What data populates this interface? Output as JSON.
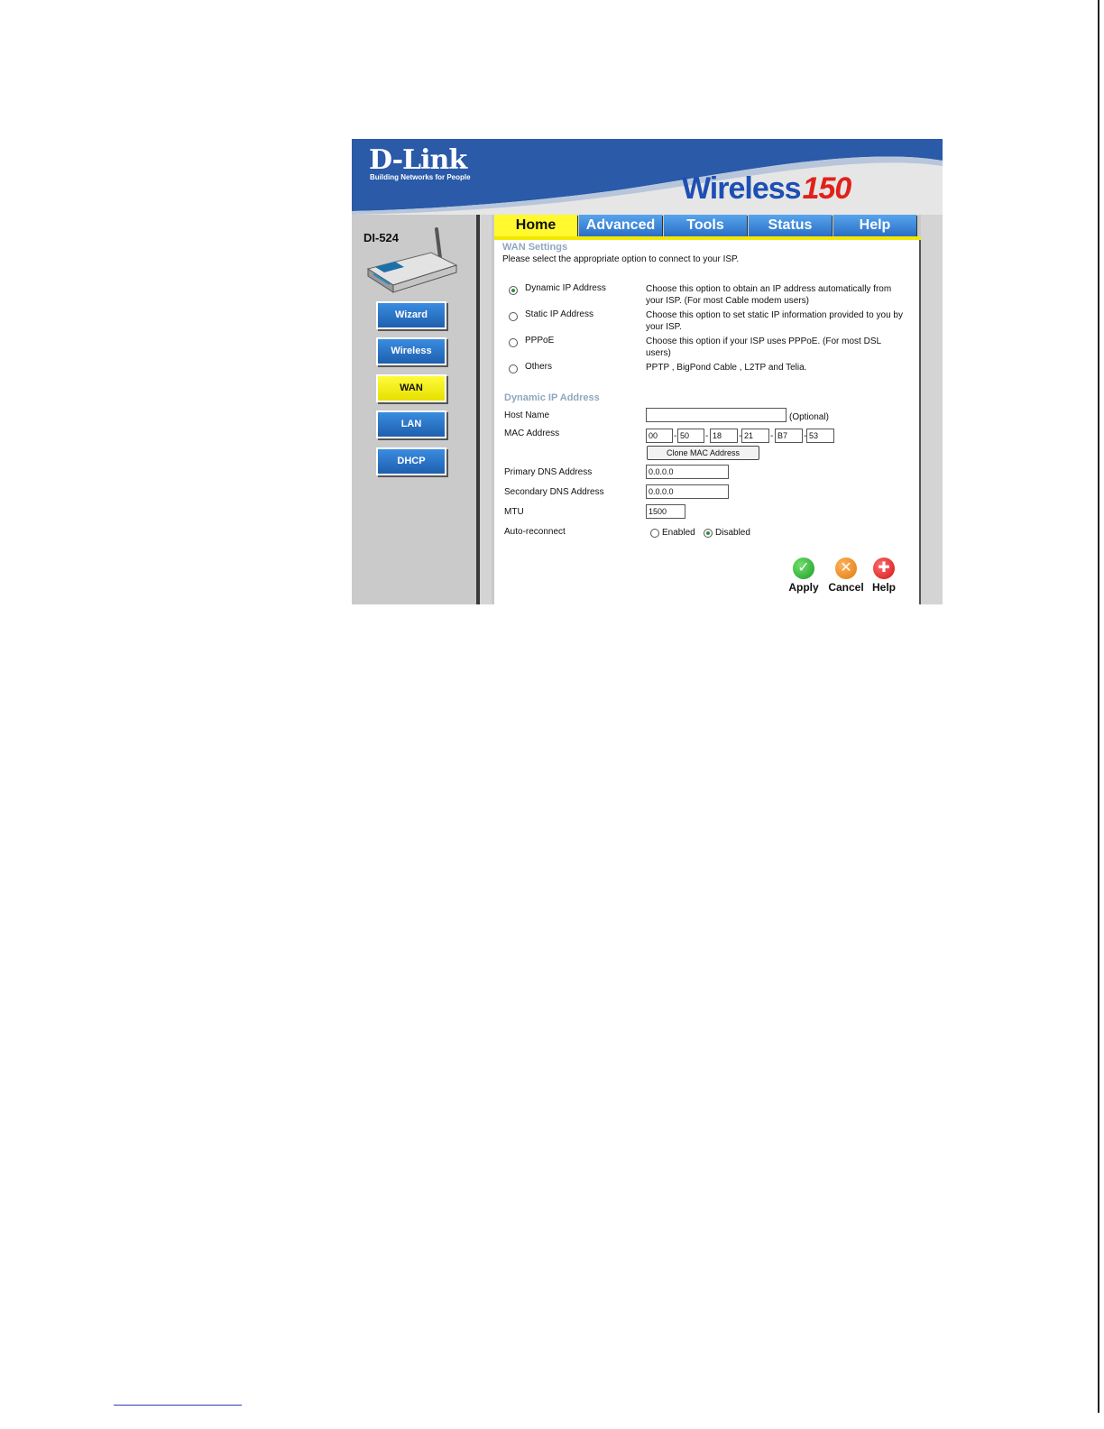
{
  "header": {
    "logo": "D-Link",
    "tagline": "Building Networks for People",
    "brand_word": "Wireless",
    "brand_number": "150"
  },
  "sidebar": {
    "model": "DI-524",
    "items": [
      {
        "label": "Wizard",
        "active": false
      },
      {
        "label": "Wireless",
        "active": false
      },
      {
        "label": "WAN",
        "active": true
      },
      {
        "label": "LAN",
        "active": false
      },
      {
        "label": "DHCP",
        "active": false
      }
    ]
  },
  "tabs": [
    {
      "label": "Home",
      "active": true
    },
    {
      "label": "Advanced",
      "active": false
    },
    {
      "label": "Tools",
      "active": false
    },
    {
      "label": "Status",
      "active": false
    },
    {
      "label": "Help",
      "active": false
    }
  ],
  "wan": {
    "title": "WAN Settings",
    "instruction": "Please select the appropriate option to connect to your ISP.",
    "options": [
      {
        "label": "Dynamic IP Address",
        "desc": "Choose this option to obtain an IP address automatically from your ISP. (For most Cable modem users)",
        "selected": true
      },
      {
        "label": "Static IP Address",
        "desc": "Choose this option to set static IP information provided to you by your ISP.",
        "selected": false
      },
      {
        "label": "PPPoE",
        "desc": "Choose this option if your ISP uses PPPoE. (For most DSL users)",
        "selected": false
      },
      {
        "label": "Others",
        "desc": "PPTP , BigPond Cable , L2TP and Telia.",
        "selected": false
      }
    ]
  },
  "dynamic": {
    "title": "Dynamic IP Address",
    "host_label": "Host Name",
    "host_value": "",
    "optional": "(Optional)",
    "mac_label": "MAC Address",
    "mac": [
      "00",
      "50",
      "18",
      "21",
      "B7",
      "53"
    ],
    "clone_button": "Clone MAC Address",
    "primary_dns_label": "Primary DNS Address",
    "primary_dns": "0.0.0.0",
    "secondary_dns_label": "Secondary DNS Address",
    "secondary_dns": "0.0.0.0",
    "mtu_label": "MTU",
    "mtu": "1500",
    "auto_label": "Auto-reconnect",
    "auto_enabled": "Enabled",
    "auto_disabled": "Disabled",
    "auto_selected": "Disabled"
  },
  "actions": {
    "apply": "Apply",
    "cancel": "Cancel",
    "help": "Help"
  },
  "colors": {
    "header_blue": "#2a5aa8",
    "tab_blue": "#3a86dc",
    "active_yellow": "#fff92e",
    "section_title": "#8fa7c1"
  }
}
